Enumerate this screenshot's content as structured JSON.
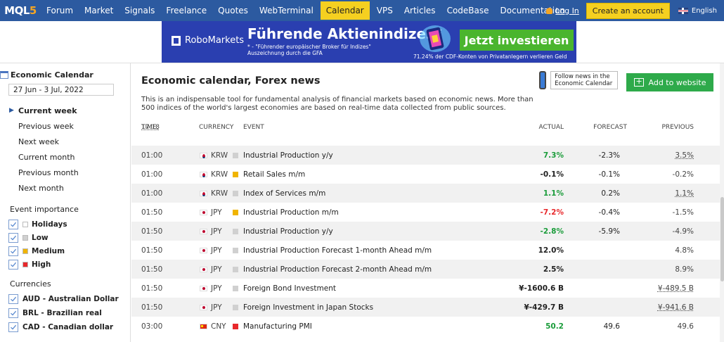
{
  "nav": {
    "logo": "MQL5",
    "items": [
      "Forum",
      "Market",
      "Signals",
      "Freelance",
      "Quotes",
      "WebTerminal",
      "Calendar",
      "VPS",
      "Articles",
      "CodeBase",
      "Documentation"
    ],
    "active": "Calendar",
    "login": "Log In",
    "create_account": "Create an account",
    "language": "English"
  },
  "banner": {
    "brand": "RoboMarkets",
    "headline": "Führende Aktienindizes*",
    "sub1": "* - \"Führender europäischer Broker für Indizes\"",
    "sub2": "Auszeichnung durch die GFA",
    "cta": "Jetzt investieren",
    "disclaimer": "71.24% der CDF-Konten von Privatanlegern verlieren Geld"
  },
  "sidebar": {
    "title": "Economic Calendar",
    "date_range": "27 Jun - 3 Jul, 2022",
    "periods": [
      "Current week",
      "Previous week",
      "Next week",
      "Current month",
      "Previous month",
      "Next month"
    ],
    "active_period": "Current week",
    "importance_title": "Event importance",
    "importance": [
      {
        "label": "Holidays",
        "color": "#ffffff",
        "checked": true
      },
      {
        "label": "Low",
        "color": "#d0d0d0",
        "checked": true
      },
      {
        "label": "Medium",
        "color": "#f0b400",
        "checked": true
      },
      {
        "label": "High",
        "color": "#e8282b",
        "checked": true
      }
    ],
    "currencies_title": "Currencies",
    "currencies": [
      {
        "label": "AUD - Australian Dollar",
        "checked": true
      },
      {
        "label": "BRL - Brazilian real",
        "checked": true
      },
      {
        "label": "CAD - Canadian dollar",
        "checked": true
      }
    ]
  },
  "main": {
    "title": "Economic calendar, Forex news",
    "description": "This is an indispensable tool for fundamental analysis of financial markets based on economic news. More than 500 indices of the world's largest economies are based on real-time data collected from public sources.",
    "follow_text": "Follow news in the Economic Calendar",
    "add_button": "Add to website",
    "headers": {
      "time": "TIME,",
      "time_value": "17:18",
      "currency": "CURRENCY",
      "event": "EVENT",
      "actual": "ACTUAL",
      "forecast": "FORECAST",
      "previous": "PREVIOUS"
    },
    "rows": [
      {
        "time": "01:00",
        "flag": "kr",
        "currency": "KRW",
        "importance": "low",
        "event": "Industrial Production y/y",
        "actual": "7.3%",
        "actual_color": "#1a9c3a",
        "forecast": "-2.3%",
        "previous": "3.5%",
        "prev_underline": true
      },
      {
        "time": "01:00",
        "flag": "kr",
        "currency": "KRW",
        "importance": "medium",
        "event": "Retail Sales m/m",
        "actual": "-0.1%",
        "actual_color": "#222222",
        "forecast": "-0.1%",
        "previous": "-0.2%",
        "prev_underline": false
      },
      {
        "time": "01:00",
        "flag": "kr",
        "currency": "KRW",
        "importance": "low",
        "event": "Index of Services m/m",
        "actual": "1.1%",
        "actual_color": "#1a9c3a",
        "forecast": "0.2%",
        "previous": "1.1%",
        "prev_underline": true
      },
      {
        "time": "01:50",
        "flag": "jp",
        "currency": "JPY",
        "importance": "medium",
        "event": "Industrial Production m/m",
        "actual": "-7.2%",
        "actual_color": "#e8282b",
        "forecast": "-0.4%",
        "previous": "-1.5%",
        "prev_underline": false
      },
      {
        "time": "01:50",
        "flag": "jp",
        "currency": "JPY",
        "importance": "low",
        "event": "Industrial Production y/y",
        "actual": "-2.8%",
        "actual_color": "#1a9c3a",
        "forecast": "-5.9%",
        "previous": "-4.9%",
        "prev_underline": false
      },
      {
        "time": "01:50",
        "flag": "jp",
        "currency": "JPY",
        "importance": "low",
        "event": "Industrial Production Forecast 1-month Ahead m/m",
        "actual": "12.0%",
        "actual_color": "#222222",
        "forecast": "",
        "previous": "4.8%",
        "prev_underline": false
      },
      {
        "time": "01:50",
        "flag": "jp",
        "currency": "JPY",
        "importance": "low",
        "event": "Industrial Production Forecast 2-month Ahead m/m",
        "actual": "2.5%",
        "actual_color": "#222222",
        "forecast": "",
        "previous": "8.9%",
        "prev_underline": false
      },
      {
        "time": "01:50",
        "flag": "jp",
        "currency": "JPY",
        "importance": "low",
        "event": "Foreign Bond Investment",
        "actual": "¥-1600.6 B",
        "actual_color": "#222222",
        "forecast": "",
        "previous": "¥-489.5 B",
        "prev_underline": true
      },
      {
        "time": "01:50",
        "flag": "jp",
        "currency": "JPY",
        "importance": "low",
        "event": "Foreign Investment in Japan Stocks",
        "actual": "¥-429.7 B",
        "actual_color": "#222222",
        "forecast": "",
        "previous": "¥-941.6 B",
        "prev_underline": true
      },
      {
        "time": "03:00",
        "flag": "cn",
        "currency": "CNY",
        "importance": "high",
        "event": "Manufacturing PMI",
        "actual": "50.2",
        "actual_color": "#1a9c3a",
        "forecast": "49.6",
        "previous": "49.6",
        "prev_underline": false
      }
    ]
  },
  "colors": {
    "nav_bg": "#2c5aa0",
    "accent_yellow": "#f5d020",
    "add_green": "#2eaa4a",
    "imp_low": "#d0d0d0",
    "imp_medium": "#f0b400",
    "imp_high": "#e8282b"
  }
}
